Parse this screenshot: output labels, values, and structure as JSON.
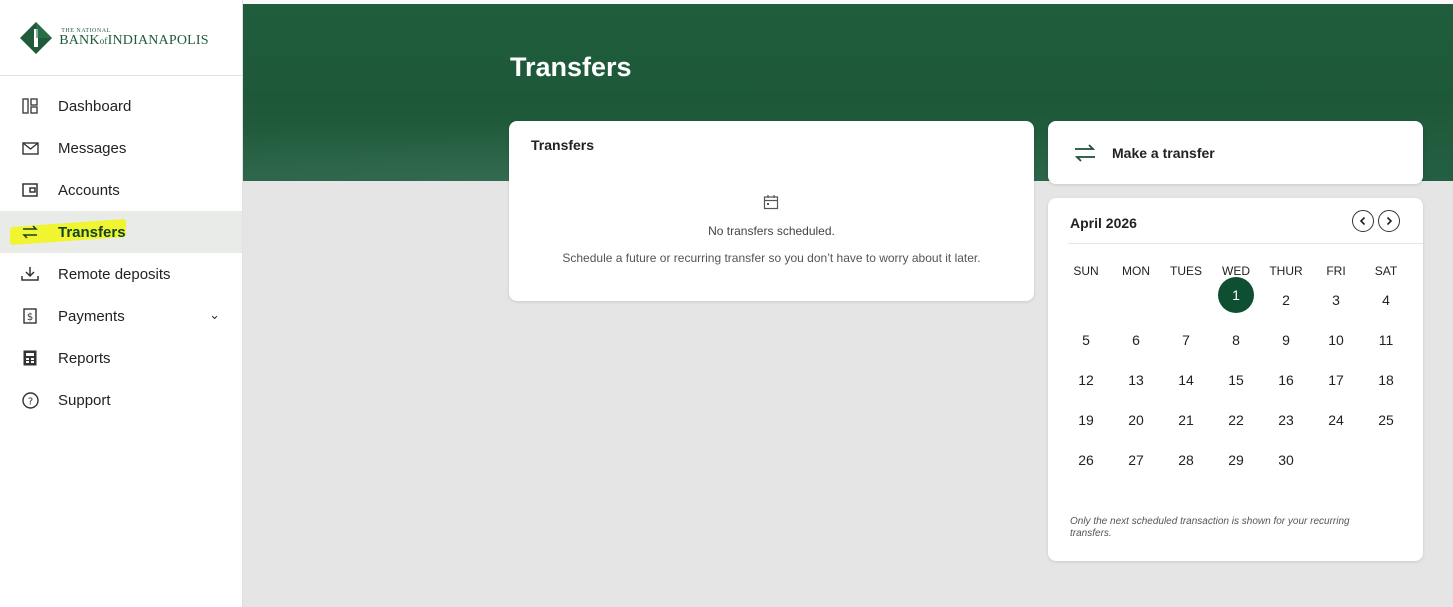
{
  "brand": {
    "logo_small": "THE NATIONAL",
    "logo_big": "BANK of INDIANAPOLIS",
    "color": "#1f5a3a"
  },
  "sidebar": {
    "items": [
      {
        "label": "Dashboard",
        "icon": "dashboard-icon"
      },
      {
        "label": "Messages",
        "icon": "envelope-icon"
      },
      {
        "label": "Accounts",
        "icon": "wallet-icon"
      },
      {
        "label": "Transfers",
        "icon": "transfer-arrows-icon",
        "active": true
      },
      {
        "label": "Remote deposits",
        "icon": "download-tray-icon"
      },
      {
        "label": "Payments",
        "icon": "dollar-doc-icon",
        "expandable": true
      },
      {
        "label": "Reports",
        "icon": "calculator-icon"
      },
      {
        "label": "Support",
        "icon": "question-circle-icon"
      }
    ]
  },
  "page": {
    "title": "Transfers"
  },
  "transfers_card": {
    "title": "Transfers",
    "empty_title": "No transfers scheduled.",
    "empty_desc": "Schedule a future or recurring transfer so you don’t have to worry about it later."
  },
  "make_transfer": {
    "label": "Make a transfer"
  },
  "calendar": {
    "month": "April 2026",
    "weekdays": [
      "SUN",
      "MON",
      "TUES",
      "WED",
      "THUR",
      "FRI",
      "SAT"
    ],
    "weeks": [
      [
        "",
        "",
        "",
        "1",
        "2",
        "3",
        "4"
      ],
      [
        "5",
        "6",
        "7",
        "8",
        "9",
        "10",
        "11"
      ],
      [
        "12",
        "13",
        "14",
        "15",
        "16",
        "17",
        "18"
      ],
      [
        "19",
        "20",
        "21",
        "22",
        "23",
        "24",
        "25"
      ],
      [
        "26",
        "27",
        "28",
        "29",
        "30",
        "",
        ""
      ]
    ],
    "today": "1",
    "note": "Only the next scheduled transaction is shown for your recurring transfers."
  },
  "colors": {
    "banner": "#1f5d3c",
    "accent": "#0f4f31",
    "highlight": "#f3f700"
  }
}
